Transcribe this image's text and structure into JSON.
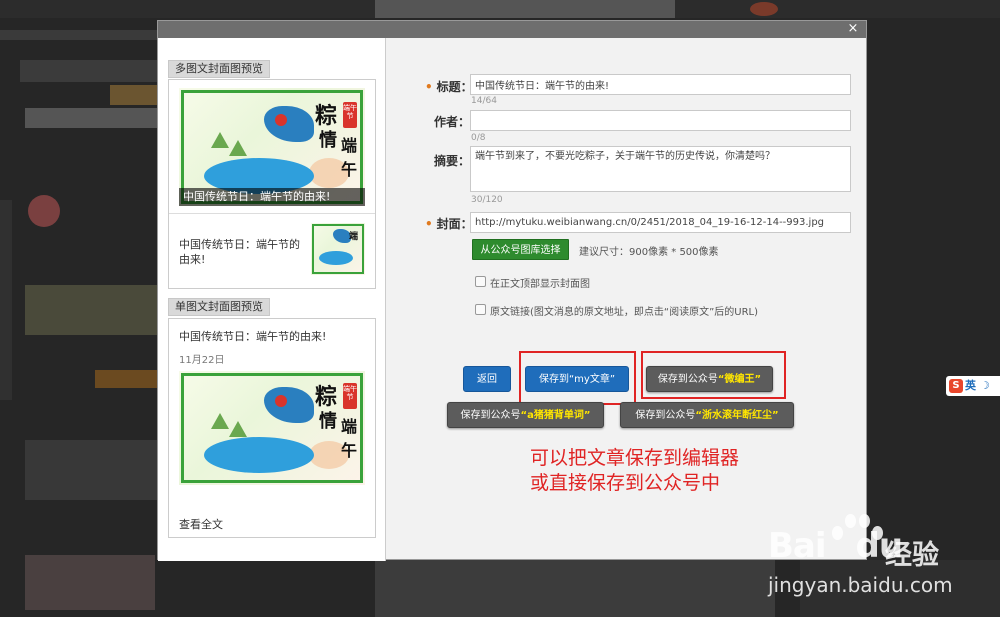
{
  "modal": {
    "close_icon": "close-icon",
    "close_glyph": "×"
  },
  "left": {
    "multi_preview_label": "多图文封面图预览",
    "main_caption": "中国传统节日：端午节的由来!",
    "sub_title": "中国传统节日：端午节的由来!",
    "single_preview_label": "单图文封面图预览",
    "single_title": "中国传统节日：端午节的由来!",
    "single_date": "11月22日",
    "read_more": "查看全文",
    "art_text_1": "粽",
    "art_text_2": "情",
    "art_text_3": "端",
    "art_text_4": "午",
    "seal_text": "端午节"
  },
  "form": {
    "title_label": "标题：",
    "title_value": "中国传统节日：端午节的由来!",
    "title_counter": "14/64",
    "author_label": "作者：",
    "author_value": "",
    "author_counter": "0/8",
    "summary_label": "摘要：",
    "summary_value": "端午节到来了，不要光吃粽子，关于端午节的历史传说，你清楚吗？",
    "summary_counter": "30/120",
    "cover_label": "封面：",
    "cover_value": "http://mytuku.weibianwang.cn/0/2451/2018_04_19-16-12-14--993.jpg",
    "choose_button": "从公众号图库选择",
    "size_hint": "建议尺寸：900像素 * 500像素",
    "show_cover_label": "在正文顶部显示封面图",
    "source_link_label": "原文链接(图文消息的原文地址，即点击“阅读原文”后的URL)"
  },
  "buttons": {
    "back": "返回",
    "save_prefix": "保存到",
    "save_target": "“my文章”",
    "save_account_prefix": "保存到公众号",
    "account_1": "“微编王”",
    "account_2": "“a猪猪背单词”",
    "account_3": "“浙水滚年断红尘”"
  },
  "annotation": {
    "line1": "可以把文章保存到编辑器",
    "line2": "或直接保存到公众号中"
  },
  "watermark": {
    "brand": "Bai",
    "brand2": "du",
    "cn": "经验",
    "url": "jingyan.baidu.com"
  },
  "ime": {
    "logo": "S",
    "label": "英",
    "moon": "☽"
  },
  "colors": {
    "accent_blue": "#1f6dbb",
    "accent_green": "#2e8b2e",
    "annotation_red": "#e02424",
    "required": "#e07a1f"
  }
}
